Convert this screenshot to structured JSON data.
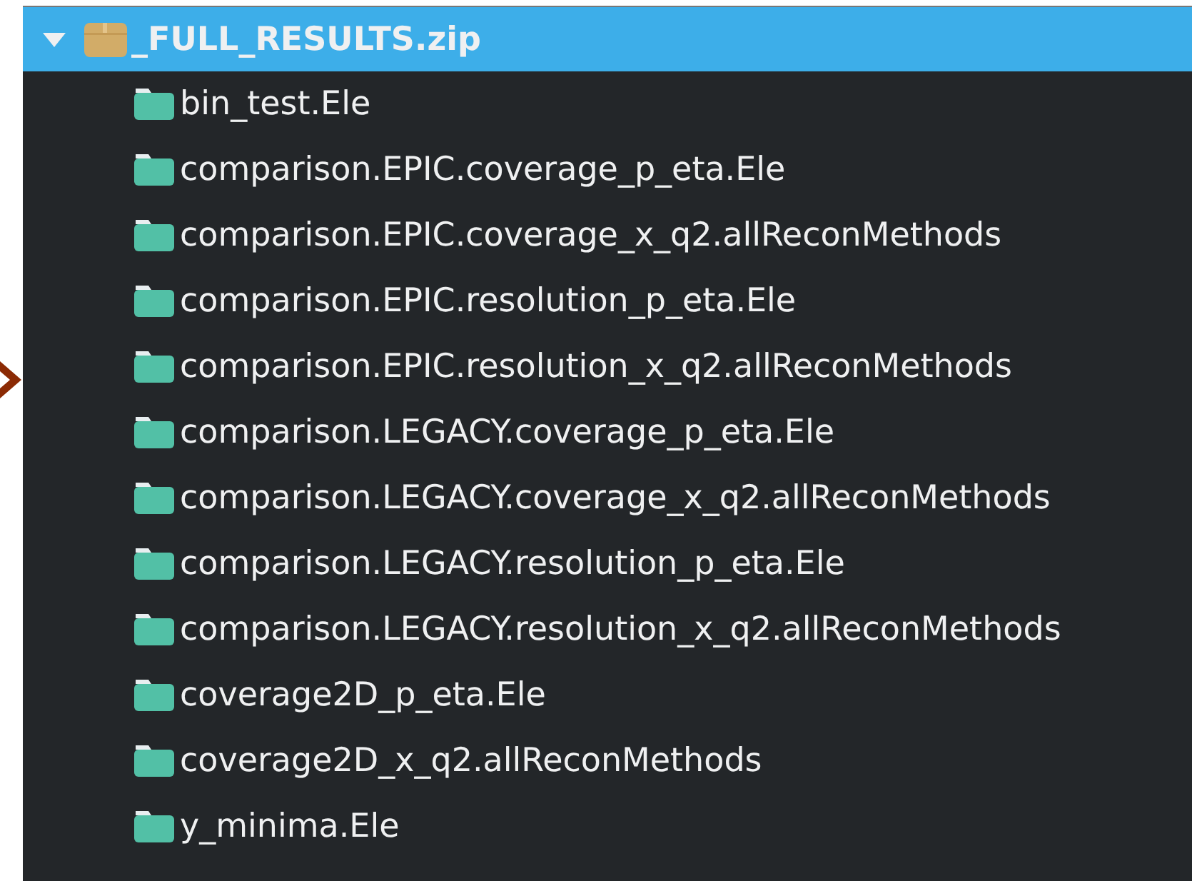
{
  "tree": {
    "label": "_FULL_RESULTS.zip",
    "kind": "archive",
    "expanded": true,
    "selected": true,
    "children": [
      {
        "label": "bin_test.Ele",
        "kind": "folder",
        "selected": false
      },
      {
        "label": "comparison.EPIC.coverage_p_eta.Ele",
        "kind": "folder",
        "selected": false
      },
      {
        "label": "comparison.EPIC.coverage_x_q2.allReconMethods",
        "kind": "folder",
        "selected": false
      },
      {
        "label": "comparison.EPIC.resolution_p_eta.Ele",
        "kind": "folder",
        "selected": false
      },
      {
        "label": "comparison.EPIC.resolution_x_q2.allReconMethods",
        "kind": "folder",
        "selected": false
      },
      {
        "label": "comparison.LEGACY.coverage_p_eta.Ele",
        "kind": "folder",
        "selected": false
      },
      {
        "label": "comparison.LEGACY.coverage_x_q2.allReconMethods",
        "kind": "folder",
        "selected": false
      },
      {
        "label": "comparison.LEGACY.resolution_p_eta.Ele",
        "kind": "folder",
        "selected": false
      },
      {
        "label": "comparison.LEGACY.resolution_x_q2.allReconMethods",
        "kind": "folder",
        "selected": false
      },
      {
        "label": "coverage2D_p_eta.Ele",
        "kind": "folder",
        "selected": false
      },
      {
        "label": "coverage2D_x_q2.allReconMethods",
        "kind": "folder",
        "selected": false
      },
      {
        "label": "y_minima.Ele",
        "kind": "folder",
        "selected": false
      }
    ]
  }
}
